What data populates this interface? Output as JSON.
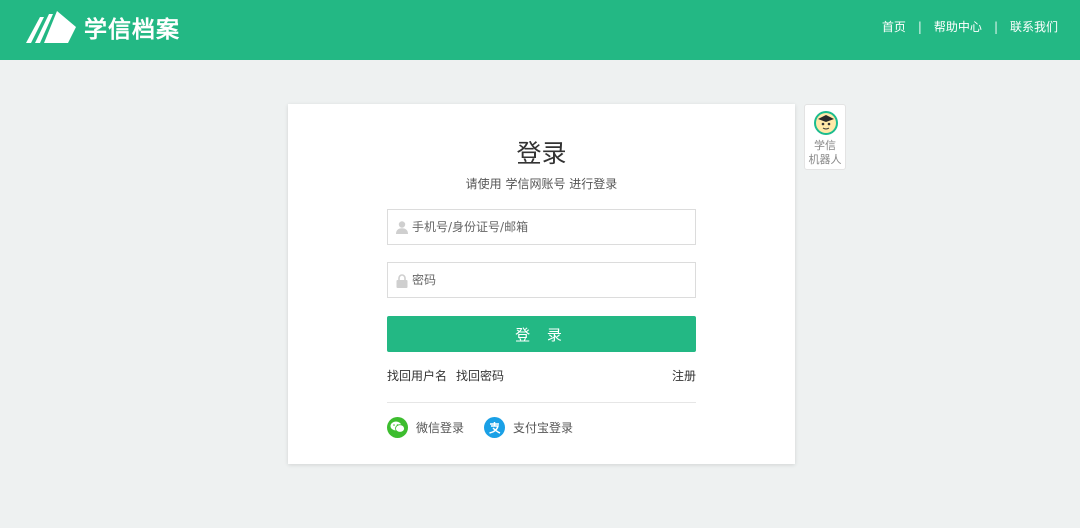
{
  "header": {
    "logo_text": "学信档案",
    "nav": [
      "首页",
      "帮助中心",
      "联系我们"
    ],
    "separator": "|"
  },
  "login": {
    "title": "登录",
    "subtitle": "请使用 学信网账号 进行登录",
    "username_placeholder": "手机号/身份证号/邮箱",
    "password_placeholder": "密码",
    "button_label": "登 录",
    "find_username": "找回用户名",
    "find_password": "找回密码",
    "register": "注册",
    "wechat_login": "微信登录",
    "alipay_login": "支付宝登录"
  },
  "robot": {
    "label_line1": "学信",
    "label_line2": "机器人"
  },
  "colors": {
    "brand": "#23b884",
    "page_bg": "#eef1f1",
    "wechat": "#3dbd2f",
    "alipay": "#1aa0e6"
  },
  "icons": [
    "logo-books-icon",
    "user-icon",
    "lock-icon",
    "wechat-icon",
    "alipay-icon",
    "robot-avatar-icon"
  ]
}
